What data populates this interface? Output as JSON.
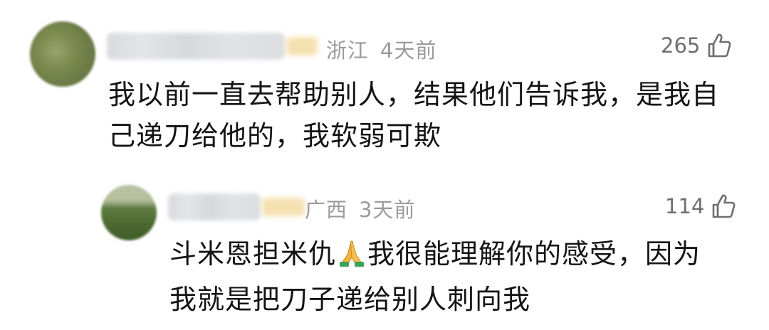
{
  "comments": [
    {
      "location": "浙江",
      "time": "4天前",
      "likes": "265",
      "text_lines": [
        "我以前一直去帮助别人，结果他们告诉我，是我自",
        "己递刀给他的，我软弱可欺"
      ]
    },
    {
      "location": "广西",
      "time": "3天前",
      "likes": "114",
      "text_before_emoji": "斗米恩担米仇",
      "emoji": "folded-hands",
      "text_after_emoji": "我很能理解你的感受，因为",
      "text_line2": "我就是把刀子递给别人刺向我"
    }
  ],
  "icons": {
    "like": "thumbs-up-icon",
    "emoji": "folded-hands-icon"
  },
  "colors": {
    "meta_text": "#9b9b9b",
    "like_text": "#6f6f6f",
    "body_text": "#141414",
    "emoji_hands": "#f2b33d",
    "emoji_sleeve": "#3aa55a"
  }
}
